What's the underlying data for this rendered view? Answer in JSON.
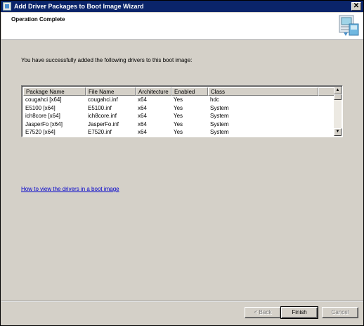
{
  "window": {
    "title": "Add Driver Packages to Boot Image Wizard",
    "close_glyph": "✕"
  },
  "header": {
    "heading": "Operation Complete"
  },
  "main": {
    "intro": "You have successfully added the following drivers to this boot image:",
    "table": {
      "columns": [
        "Package Name",
        "File Name",
        "Architecture",
        "Enabled",
        "Class"
      ],
      "rows": [
        [
          "cougahci [x64]",
          "cougahci.inf",
          "x64",
          "Yes",
          "hdc"
        ],
        [
          "E5100 [x64]",
          "E5100.inf",
          "x64",
          "Yes",
          "System"
        ],
        [
          "ich8core [x64]",
          "ich8core.inf",
          "x64",
          "Yes",
          "System"
        ],
        [
          "JasperFo [x64]",
          "JasperFo.inf",
          "x64",
          "Yes",
          "System"
        ],
        [
          "E7520 [x64]",
          "E7520.inf",
          "x64",
          "Yes",
          "System"
        ]
      ]
    },
    "help_link": "How to view the drivers in a boot image"
  },
  "buttons": {
    "back": "< Back",
    "finish": "Finish",
    "cancel": "Cancel"
  },
  "icons": {
    "scroll_up": "▲",
    "scroll_down": "▼"
  },
  "colors": {
    "titlebar": "#0a246a",
    "dialog_bg": "#d4d0c8",
    "link": "#0000cc"
  }
}
